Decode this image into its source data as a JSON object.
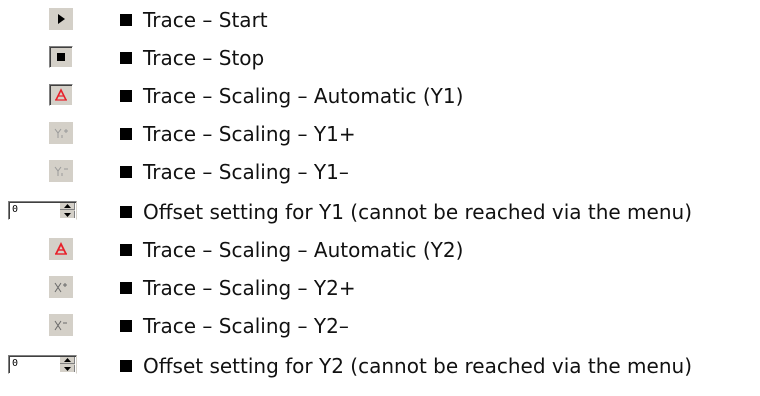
{
  "items": [
    {
      "kind": "button",
      "icon": "play-icon",
      "label": "Trace – Start"
    },
    {
      "kind": "button",
      "icon": "stop-icon",
      "label": "Trace – Stop"
    },
    {
      "kind": "button",
      "icon": "autoscale-y1-icon",
      "label": "Trace – Scaling – Automatic (Y1)"
    },
    {
      "kind": "button",
      "icon": "y1-plus-icon",
      "label": "Trace – Scaling – Y1+"
    },
    {
      "kind": "button",
      "icon": "y1-minus-icon",
      "label": "Trace – Scaling – Y1–"
    },
    {
      "kind": "spinner",
      "value": "0",
      "label": "Offset setting for Y1 (cannot be reached via the menu)"
    },
    {
      "kind": "button",
      "icon": "autoscale-y2-icon",
      "label": "Trace – Scaling – Automatic (Y2)"
    },
    {
      "kind": "button",
      "icon": "y2-plus-icon",
      "label": "Trace – Scaling – Y2+"
    },
    {
      "kind": "button",
      "icon": "y2-minus-icon",
      "label": "Trace – Scaling – Y2–"
    },
    {
      "kind": "spinner",
      "value": "0",
      "label": "Offset setting for Y2 (cannot be reached via the menu)"
    }
  ],
  "colors": {
    "accent_red": "#e8202a",
    "disabled_gray": "#9a9a9a",
    "button_face": "#d4d0c8"
  }
}
